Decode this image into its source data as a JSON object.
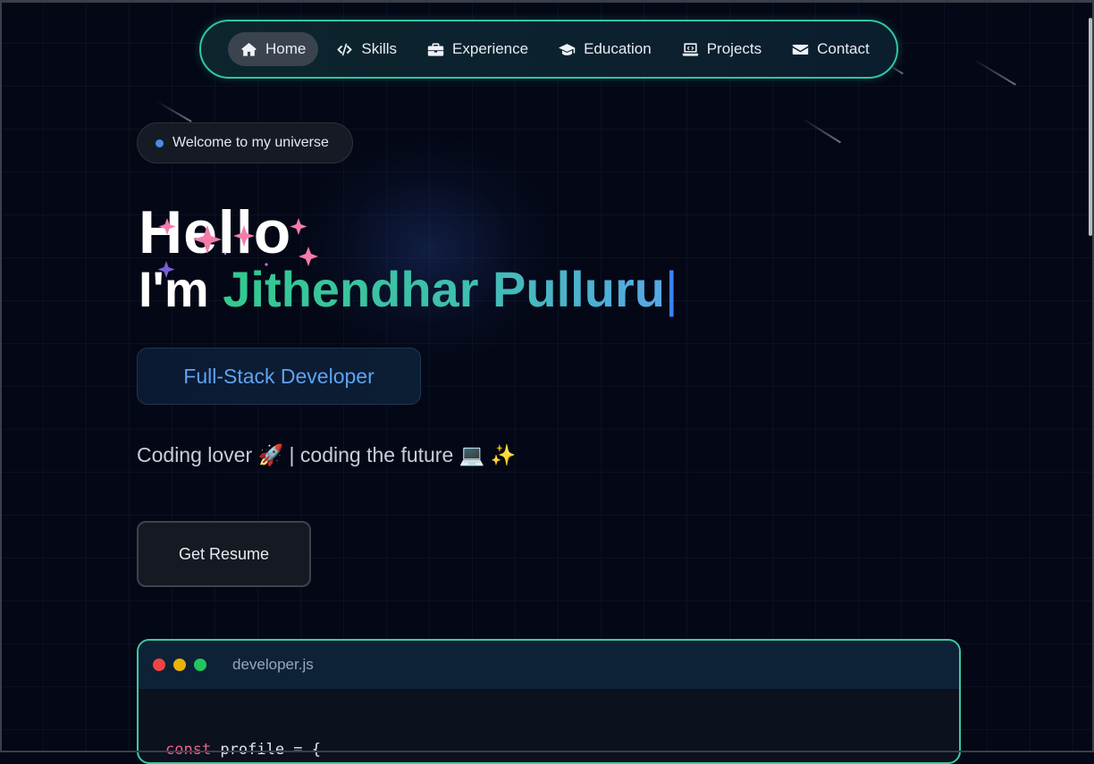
{
  "nav": {
    "items": [
      {
        "label": "Home",
        "icon": "home-icon",
        "active": true
      },
      {
        "label": "Skills",
        "icon": "code-icon"
      },
      {
        "label": "Experience",
        "icon": "briefcase-icon"
      },
      {
        "label": "Education",
        "icon": "graduation-cap-icon"
      },
      {
        "label": "Projects",
        "icon": "laptop-code-icon"
      },
      {
        "label": "Contact",
        "icon": "envelope-icon"
      }
    ]
  },
  "hero": {
    "badge": "Welcome to my universe",
    "greeting": "Hello",
    "intro_prefix": "I'm",
    "name": "Jithendhar Pulluru",
    "cursor": "|",
    "role": "Full-Stack Developer",
    "tagline": "Coding lover 🚀 | coding the future 💻 ✨",
    "cta": "Get Resume"
  },
  "code_window": {
    "filename": "developer.js",
    "first_line_keyword": "const",
    "first_line_rest": " profile = {"
  },
  "colors": {
    "accent_teal": "#2ec6a3",
    "accent_blue": "#5fa2f0",
    "background": "#040816"
  }
}
